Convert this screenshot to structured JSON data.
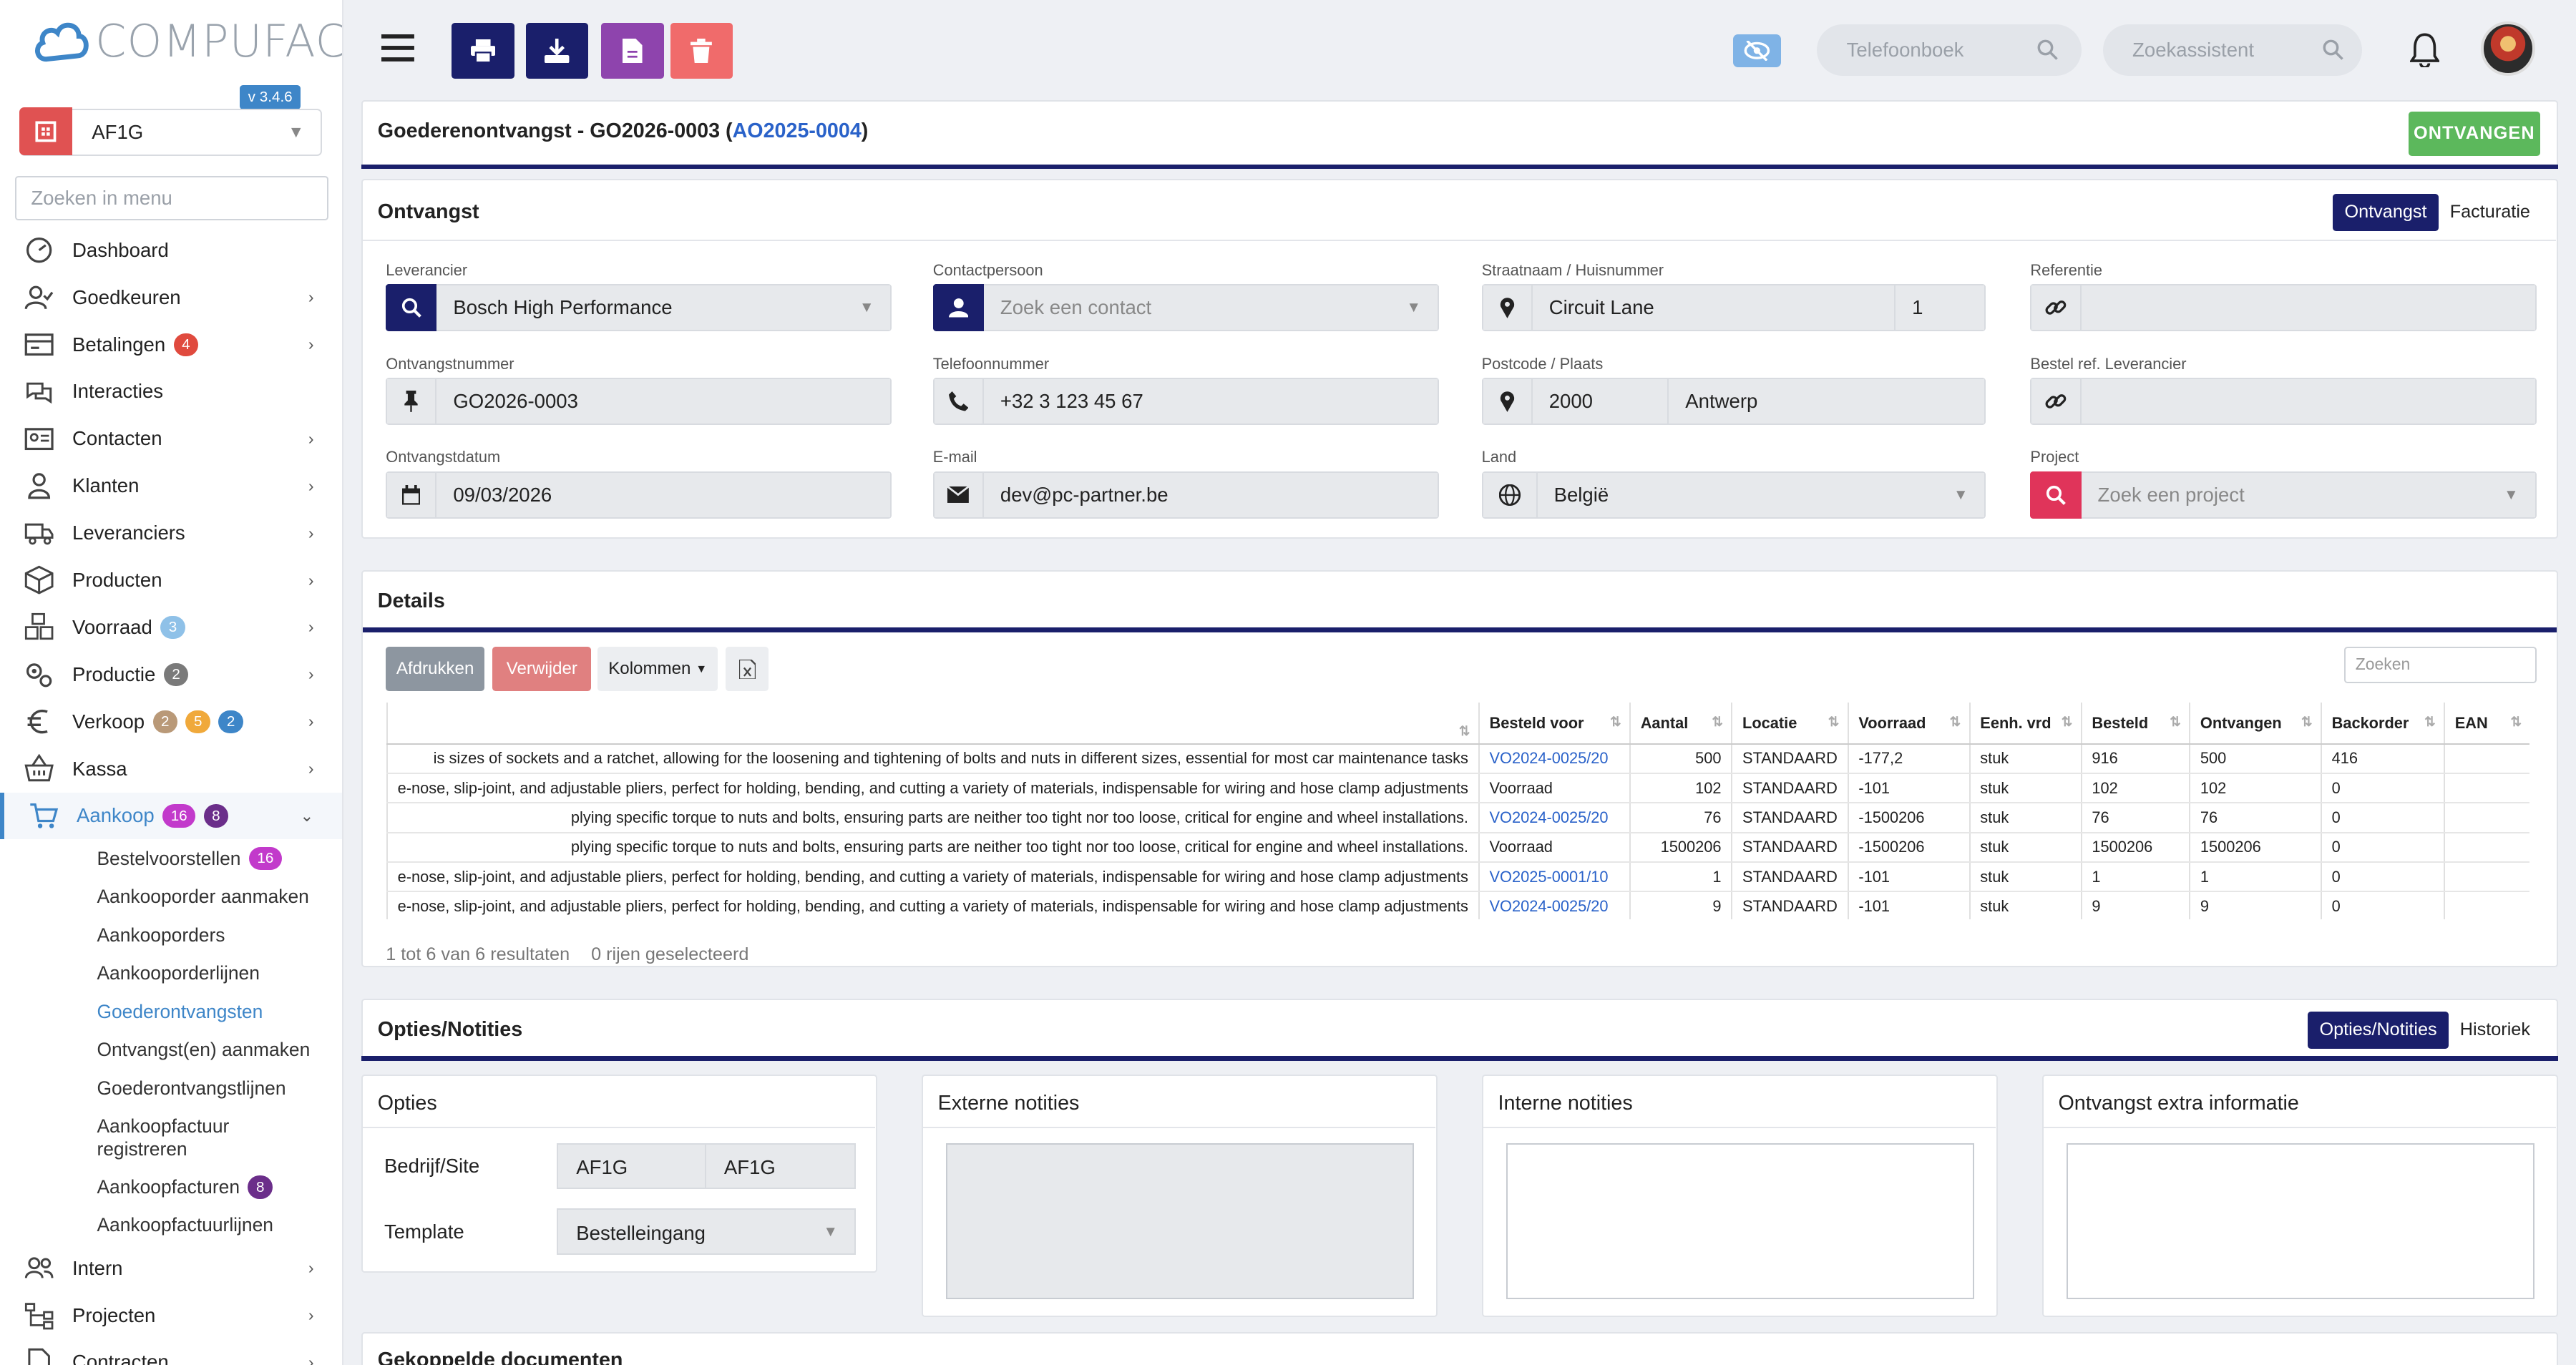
{
  "app": {
    "logo": "COMPUFACT",
    "version": "v 3.4.6",
    "company": "AF1G",
    "menu_search_placeholder": "Zoeken in menu"
  },
  "nav": [
    {
      "label": "Dashboard",
      "icon": "dashboard-icon",
      "chev": false,
      "badges": []
    },
    {
      "label": "Goedkeuren",
      "icon": "user-check-icon",
      "chev": true,
      "badges": []
    },
    {
      "label": "Betalingen",
      "icon": "wallet-icon",
      "chev": true,
      "badges": [
        {
          "v": "4",
          "c": "b-red"
        }
      ]
    },
    {
      "label": "Interacties",
      "icon": "chat-icon",
      "chev": false,
      "badges": []
    },
    {
      "label": "Contacten",
      "icon": "contact-card-icon",
      "chev": true,
      "badges": []
    },
    {
      "label": "Klanten",
      "icon": "person-icon",
      "chev": true,
      "badges": []
    },
    {
      "label": "Leveranciers",
      "icon": "truck-icon",
      "chev": true,
      "badges": []
    },
    {
      "label": "Producten",
      "icon": "box-icon",
      "chev": true,
      "badges": []
    },
    {
      "label": "Voorraad",
      "icon": "boxes-icon",
      "chev": true,
      "badges": [
        {
          "v": "3",
          "c": "b-lblue"
        }
      ]
    },
    {
      "label": "Productie",
      "icon": "gears-icon",
      "chev": true,
      "badges": [
        {
          "v": "2",
          "c": "b-gray"
        }
      ]
    },
    {
      "label": "Verkoop",
      "icon": "euro-icon",
      "chev": true,
      "badges": [
        {
          "v": "2",
          "c": "b-brown"
        },
        {
          "v": "5",
          "c": "b-orange"
        },
        {
          "v": "2",
          "c": "b-blue"
        }
      ]
    },
    {
      "label": "Kassa",
      "icon": "basket-icon",
      "chev": true,
      "badges": []
    },
    {
      "label": "Aankoop",
      "icon": "cart-icon",
      "chev": true,
      "active": true,
      "badges": [
        {
          "v": "16",
          "c": "b-pink"
        },
        {
          "v": "8",
          "c": "b-purple"
        }
      ]
    }
  ],
  "subnav": [
    {
      "label": "Bestelvoorstellen",
      "badge": "16",
      "bc": "b-pink"
    },
    {
      "label": "Aankooporder aanmaken"
    },
    {
      "label": "Aankooporders"
    },
    {
      "label": "Aankooporderlijnen"
    },
    {
      "label": "Goederontvangsten",
      "active": true
    },
    {
      "label": "Ontvangst(en) aanmaken"
    },
    {
      "label": "Goederontvangstlijnen"
    },
    {
      "label": "Aankoopfactuur registreren",
      "tall": true
    },
    {
      "label": "Aankoopfacturen",
      "badge": "8",
      "bc": "b-purple"
    },
    {
      "label": "Aankoopfactuurlijnen"
    }
  ],
  "nav_bottom": [
    {
      "label": "Intern",
      "icon": "people-icon"
    },
    {
      "label": "Projecten",
      "icon": "hierarchy-icon"
    },
    {
      "label": "Contracten",
      "icon": "document-icon"
    }
  ],
  "topbar": {
    "phonebook": "Telefoonboek",
    "assistant": "Zoekassistent"
  },
  "header": {
    "title": "Goederenontvangst - GO2026-0003 (",
    "link": "AO2025-0004",
    "close": ")",
    "receive_button": "ONTVANGEN"
  },
  "ontvangst": {
    "title": "Ontvangst",
    "tabs": [
      "Ontvangst",
      "Facturatie"
    ],
    "leverancier_label": "Leverancier",
    "leverancier": "Bosch High Performance",
    "contact_label": "Contactpersoon",
    "contact_placeholder": "Zoek een contact",
    "street_label": "Straatnaam / Huisnummer",
    "street": "Circuit Lane",
    "number": "1",
    "ref_label": "Referentie",
    "ref": "",
    "nummer_label": "Ontvangstnummer",
    "nummer": "GO2026-0003",
    "phone_label": "Telefoonnummer",
    "phone": "+32 3 123 45 67",
    "postcode_label": "Postcode / Plaats",
    "postcode": "2000",
    "plaats": "Antwerp",
    "bestelref_label": "Bestel ref. Leverancier",
    "bestelref": "",
    "datum_label": "Ontvangstdatum",
    "datum": "09/03/2026",
    "email_label": "E-mail",
    "email": "dev@pc-partner.be",
    "land_label": "Land",
    "land": "België",
    "project_label": "Project",
    "project_placeholder": "Zoek een project"
  },
  "details": {
    "title": "Details",
    "btn_print": "Afdrukken",
    "btn_delete": "Verwijder",
    "btn_columns": "Kolommen",
    "search_placeholder": "Zoeken",
    "columns": [
      "",
      "Besteld voor",
      "Aantal",
      "Locatie",
      "Voorraad",
      "Eenh. vrd",
      "Besteld",
      "Ontvangen",
      "Backorder",
      "EAN"
    ],
    "rows": [
      {
        "desc": "is sizes of sockets and a ratchet, allowing for the loosening and tightening of bolts and nuts in different sizes, essential for most car maintenance tasks",
        "voor": "VO2024-0025/20",
        "link": true,
        "aantal": "500",
        "locatie": "STANDAARD",
        "voorraad": "-177,2",
        "eenh": "stuk",
        "besteld": "916",
        "ontvangen": "500",
        "backorder": "416",
        "ean": ""
      },
      {
        "desc": "e-nose, slip-joint, and adjustable pliers, perfect for holding, bending, and cutting a variety of materials, indispensable for wiring and hose clamp adjustments",
        "voor": "Voorraad",
        "link": false,
        "aantal": "102",
        "locatie": "STANDAARD",
        "voorraad": "-101",
        "eenh": "stuk",
        "besteld": "102",
        "ontvangen": "102",
        "backorder": "0",
        "ean": ""
      },
      {
        "desc": "plying specific torque to nuts and bolts, ensuring parts are neither too tight nor too loose, critical for engine and wheel installations.",
        "voor": "VO2024-0025/20",
        "link": true,
        "aantal": "76",
        "locatie": "STANDAARD",
        "voorraad": "-1500206",
        "eenh": "stuk",
        "besteld": "76",
        "ontvangen": "76",
        "backorder": "0",
        "ean": ""
      },
      {
        "desc": "plying specific torque to nuts and bolts, ensuring parts are neither too tight nor too loose, critical for engine and wheel installations.",
        "voor": "Voorraad",
        "link": false,
        "aantal": "1500206",
        "locatie": "STANDAARD",
        "voorraad": "-1500206",
        "eenh": "stuk",
        "besteld": "1500206",
        "ontvangen": "1500206",
        "backorder": "0",
        "ean": ""
      },
      {
        "desc": "e-nose, slip-joint, and adjustable pliers, perfect for holding, bending, and cutting a variety of materials, indispensable for wiring and hose clamp adjustments",
        "voor": "VO2025-0001/10",
        "link": true,
        "aantal": "1",
        "locatie": "STANDAARD",
        "voorraad": "-101",
        "eenh": "stuk",
        "besteld": "1",
        "ontvangen": "1",
        "backorder": "0",
        "ean": ""
      },
      {
        "desc": "e-nose, slip-joint, and adjustable pliers, perfect for holding, bending, and cutting a variety of materials, indispensable for wiring and hose clamp adjustments",
        "voor": "VO2024-0025/20",
        "link": true,
        "aantal": "9",
        "locatie": "STANDAARD",
        "voorraad": "-101",
        "eenh": "stuk",
        "besteld": "9",
        "ontvangen": "9",
        "backorder": "0",
        "ean": ""
      }
    ],
    "footer_results": "1 tot 6 van 6 resultaten",
    "footer_selected": "0 rijen geselecteerd"
  },
  "opties": {
    "title": "Opties/Notities",
    "tabs": [
      "Opties/Notities",
      "Historiek"
    ],
    "opties_title": "Opties",
    "bedrijf_label": "Bedrijf/Site",
    "bedrijf1": "AF1G",
    "bedrijf2": "AF1G",
    "template_label": "Template",
    "template": "Bestelleingang",
    "extern": "Externe notities",
    "intern": "Interne notities",
    "extra": "Ontvangst extra informatie"
  },
  "documents": {
    "title": "Gekoppelde documenten"
  },
  "colors": {
    "navy": "#1a1f6b",
    "green": "#5cb85c",
    "red": "#e0345a",
    "link": "#2a62c9",
    "purple": "#8e44ad",
    "salmon": "#f06b6b"
  }
}
